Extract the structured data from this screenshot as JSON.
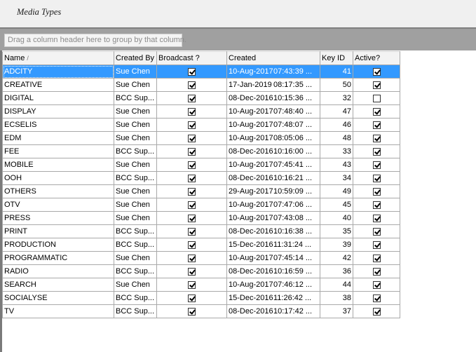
{
  "window": {
    "title": "Media Types"
  },
  "group_hint": "Drag a column header here to group by that column.",
  "columns": {
    "name": "Name",
    "created_by": "Created By",
    "broadcast": "Broadcast ?",
    "created": "Created",
    "key_id": "Key ID",
    "active": "Active?"
  },
  "selected_row": 0,
  "rows": [
    {
      "name": "ADCITY",
      "created_by": "Sue Chen",
      "broadcast": true,
      "date": "10-Aug-2017",
      "time": "07:43:39 ...",
      "key_id": "41",
      "active": true
    },
    {
      "name": "CREATIVE",
      "created_by": "Sue Chen",
      "broadcast": true,
      "date": "17-Jan-2019",
      "time": "08:17:35 ...",
      "key_id": "50",
      "active": true
    },
    {
      "name": "DIGITAL",
      "created_by": "BCC Sup...",
      "broadcast": true,
      "date": "08-Dec-2016",
      "time": "10:15:36 ...",
      "key_id": "32",
      "active": false
    },
    {
      "name": "DISPLAY",
      "created_by": "Sue Chen",
      "broadcast": true,
      "date": "10-Aug-2017",
      "time": "07:48:40 ...",
      "key_id": "47",
      "active": true
    },
    {
      "name": "ECSELIS",
      "created_by": "Sue Chen",
      "broadcast": true,
      "date": "10-Aug-2017",
      "time": "07:48:07 ...",
      "key_id": "46",
      "active": true
    },
    {
      "name": "EDM",
      "created_by": "Sue Chen",
      "broadcast": true,
      "date": "10-Aug-2017",
      "time": "08:05:06 ...",
      "key_id": "48",
      "active": true
    },
    {
      "name": "FEE",
      "created_by": "BCC Sup...",
      "broadcast": true,
      "date": "08-Dec-2016",
      "time": "10:16:00 ...",
      "key_id": "33",
      "active": true
    },
    {
      "name": "MOBILE",
      "created_by": "Sue Chen",
      "broadcast": true,
      "date": "10-Aug-2017",
      "time": "07:45:41 ...",
      "key_id": "43",
      "active": true
    },
    {
      "name": "OOH",
      "created_by": "BCC Sup...",
      "broadcast": true,
      "date": "08-Dec-2016",
      "time": "10:16:21 ...",
      "key_id": "34",
      "active": true
    },
    {
      "name": "OTHERS",
      "created_by": "Sue Chen",
      "broadcast": true,
      "date": "29-Aug-2017",
      "time": "10:59:09 ...",
      "key_id": "49",
      "active": true
    },
    {
      "name": "OTV",
      "created_by": "Sue Chen",
      "broadcast": true,
      "date": "10-Aug-2017",
      "time": "07:47:06 ...",
      "key_id": "45",
      "active": true
    },
    {
      "name": "PRESS",
      "created_by": "Sue Chen",
      "broadcast": true,
      "date": "10-Aug-2017",
      "time": "07:43:08 ...",
      "key_id": "40",
      "active": true
    },
    {
      "name": "PRINT",
      "created_by": "BCC Sup...",
      "broadcast": true,
      "date": "08-Dec-2016",
      "time": "10:16:38 ...",
      "key_id": "35",
      "active": true
    },
    {
      "name": "PRODUCTION",
      "created_by": "BCC Sup...",
      "broadcast": true,
      "date": "15-Dec-2016",
      "time": "11:31:24 ...",
      "key_id": "39",
      "active": true
    },
    {
      "name": "PROGRAMMATIC",
      "created_by": "Sue Chen",
      "broadcast": true,
      "date": "10-Aug-2017",
      "time": "07:45:14 ...",
      "key_id": "42",
      "active": true
    },
    {
      "name": "RADIO",
      "created_by": "BCC Sup...",
      "broadcast": true,
      "date": "08-Dec-2016",
      "time": "10:16:59 ...",
      "key_id": "36",
      "active": true
    },
    {
      "name": "SEARCH",
      "created_by": "Sue Chen",
      "broadcast": true,
      "date": "10-Aug-2017",
      "time": "07:46:12 ...",
      "key_id": "44",
      "active": true
    },
    {
      "name": "SOCIALYSE",
      "created_by": "BCC Sup...",
      "broadcast": true,
      "date": "15-Dec-2016",
      "time": "11:26:42 ...",
      "key_id": "38",
      "active": true
    },
    {
      "name": "TV",
      "created_by": "BCC Sup...",
      "broadcast": true,
      "date": "08-Dec-2016",
      "time": "10:17:42 ...",
      "key_id": "37",
      "active": true
    }
  ]
}
